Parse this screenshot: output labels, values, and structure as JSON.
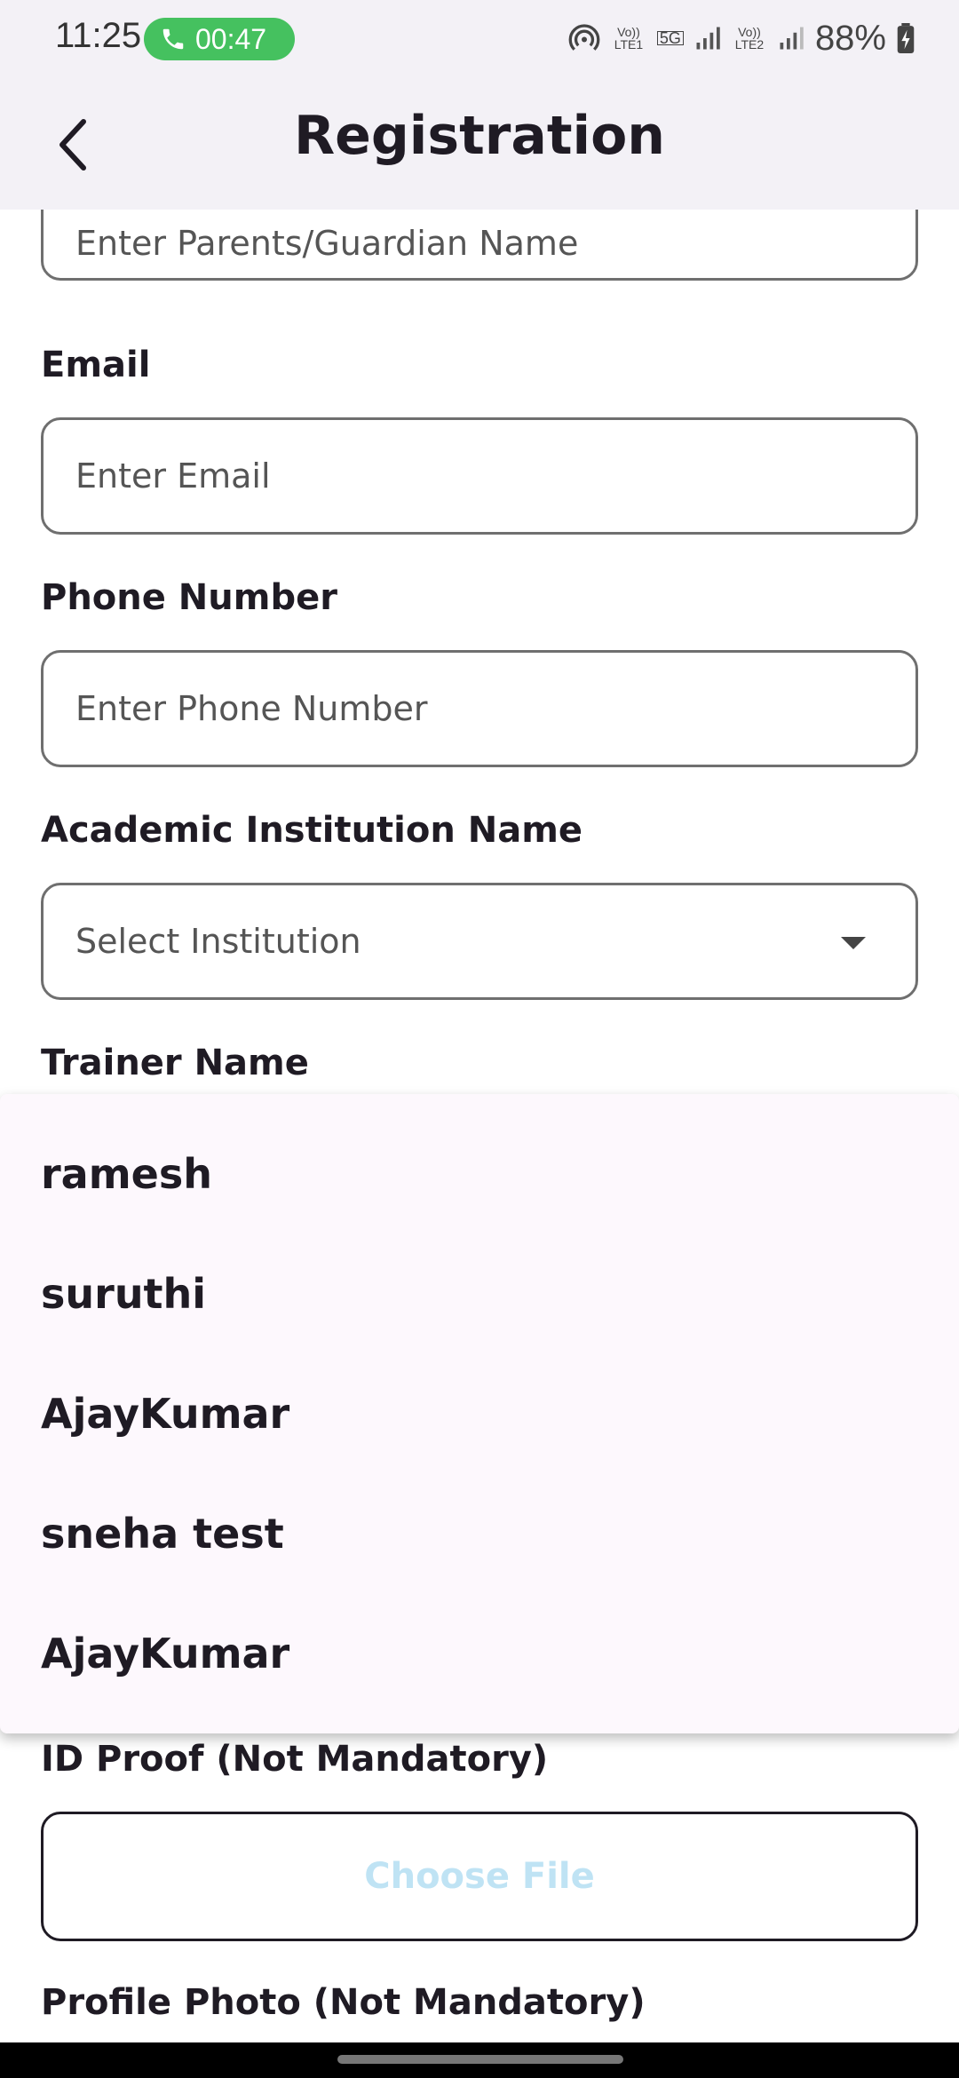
{
  "status_bar": {
    "time": "11:25",
    "call_timer": "00:47",
    "volte1_label": "Vo)) LTE1",
    "network_label": "5G",
    "volte2_label": "Vo)) LTE2",
    "battery": "88%"
  },
  "app_bar": {
    "title": "Registration"
  },
  "form": {
    "guardian_placeholder": "Enter Parents/Guardian Name",
    "email_label": "Email",
    "email_placeholder": "Enter Email",
    "phone_label": "Phone Number",
    "phone_placeholder": "Enter Phone Number",
    "institution_label": "Academic Institution Name",
    "institution_placeholder": "Select Institution",
    "trainer_label": "Trainer Name",
    "id_proof_label": "ID Proof (Not Mandatory)",
    "choose_file_label": "Choose File",
    "profile_photo_label": "Profile Photo (Not Mandatory)"
  },
  "trainer_options": [
    "ramesh",
    "suruthi",
    "AjayKumar",
    "sneha test",
    "AjayKumar"
  ],
  "colors": {
    "call_pill": "#45c15f",
    "app_bar_bg": "#f3f1f6",
    "menu_bg": "#fdf8fd",
    "choose_file_text": "#bfe3f4"
  }
}
